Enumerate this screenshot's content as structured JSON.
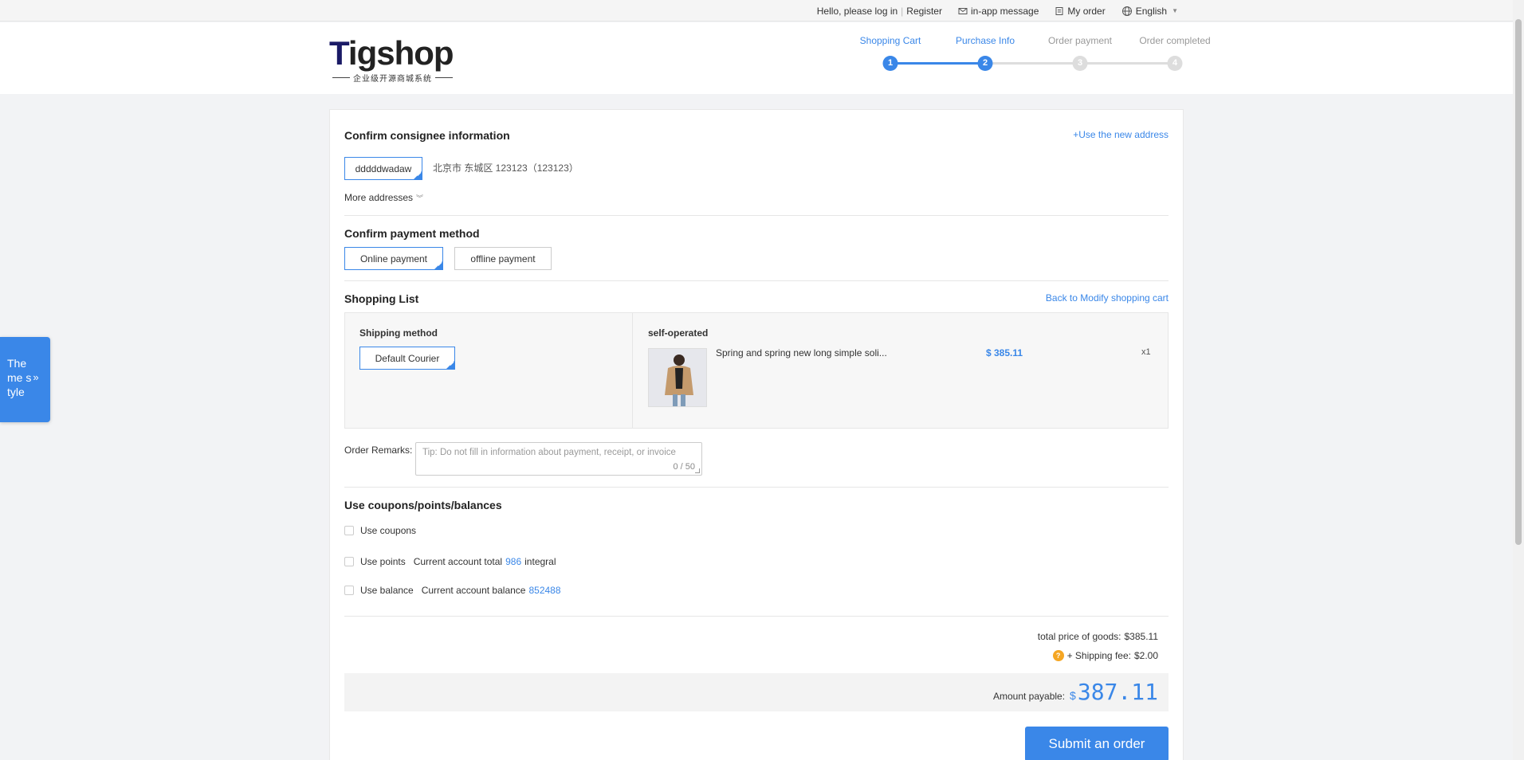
{
  "topbar": {
    "greeting": "Hello, please log in",
    "register": "Register",
    "message": "in-app message",
    "my_order": "My order",
    "language": "English"
  },
  "logo": {
    "text_t": "T",
    "text_rest": "igshop",
    "subtitle": "企业级开源商城系统"
  },
  "steps": [
    {
      "label": "Shopping Cart",
      "num": "1"
    },
    {
      "label": "Purchase Info",
      "num": "2"
    },
    {
      "label": "Order payment",
      "num": "3"
    },
    {
      "label": "Order completed",
      "num": "4"
    }
  ],
  "consignee": {
    "title": "Confirm consignee information",
    "new_address": "+Use the new address",
    "selected_name": "dddddwadaw",
    "address": "北京市 东城区 123123（123123）",
    "more": "More addresses"
  },
  "payment": {
    "title": "Confirm payment method",
    "online": "Online payment",
    "offline": "offline payment"
  },
  "shopping": {
    "title": "Shopping List",
    "back_link": "Back to Modify shopping cart",
    "shipping_title": "Shipping method",
    "courier": "Default Courier",
    "store": "self-operated",
    "product_name": "Spring and spring new long simple soli...",
    "price": "$ 385.11",
    "qty": "x1"
  },
  "remarks": {
    "label": "Order Remarks:",
    "placeholder": "Tip: Do not fill in information about payment, receipt, or invoice",
    "count": "0 / 50"
  },
  "discounts": {
    "title": "Use coupons/points/balances",
    "coupons": "Use coupons",
    "points": "Use points",
    "points_desc": "Current account total",
    "points_value": "986",
    "points_unit": "integral",
    "balance": "Use balance",
    "balance_desc": "Current account balance",
    "balance_value": "852488"
  },
  "totals": {
    "goods_label": "total price of goods:",
    "goods_value": "$385.11",
    "shipping_label": "+ Shipping fee:",
    "shipping_value": "$2.00",
    "payable_label": "Amount payable:",
    "payable_currency": "$",
    "payable_value": "387.11",
    "submit": "Submit an order"
  },
  "theme_tab": {
    "line1": "The",
    "line2": "me s",
    "line3": "tyle"
  },
  "colors": {
    "accent": "#3a87e8",
    "warning": "#f5a623"
  }
}
